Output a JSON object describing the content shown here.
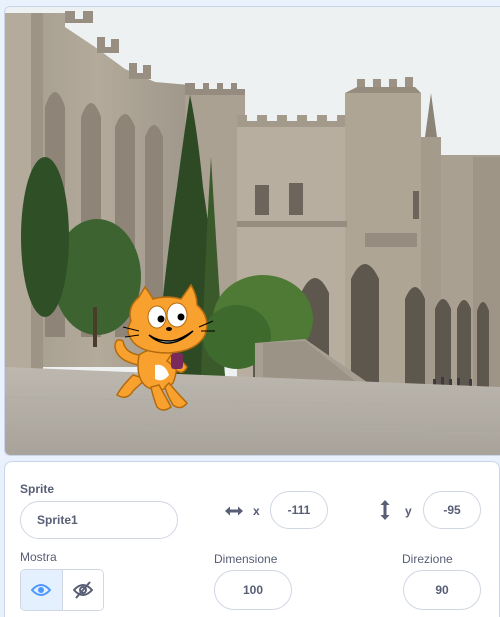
{
  "sprite_panel": {
    "sprite_label": "Sprite",
    "sprite_name": "Sprite1",
    "x_label": "x",
    "x_value": "-111",
    "y_label": "y",
    "y_value": "-95",
    "show_label": "Mostra",
    "size_label": "Dimensione",
    "size_value": "100",
    "direction_label": "Direzione",
    "direction_value": "90",
    "show_visible": true
  },
  "icons": {
    "x_axis": "horizontal-arrows-icon",
    "y_axis": "vertical-arrows-icon",
    "show": "eye-icon",
    "hide": "eye-slash-icon",
    "sprite": "scratch-cat-sprite"
  },
  "colors": {
    "accent": "#4c97ff",
    "text": "#575e75",
    "panel_bg": "#e9f1fc",
    "toggle_active_bg": "#e5f0ff",
    "sprite_orange": "#f9a12e"
  }
}
